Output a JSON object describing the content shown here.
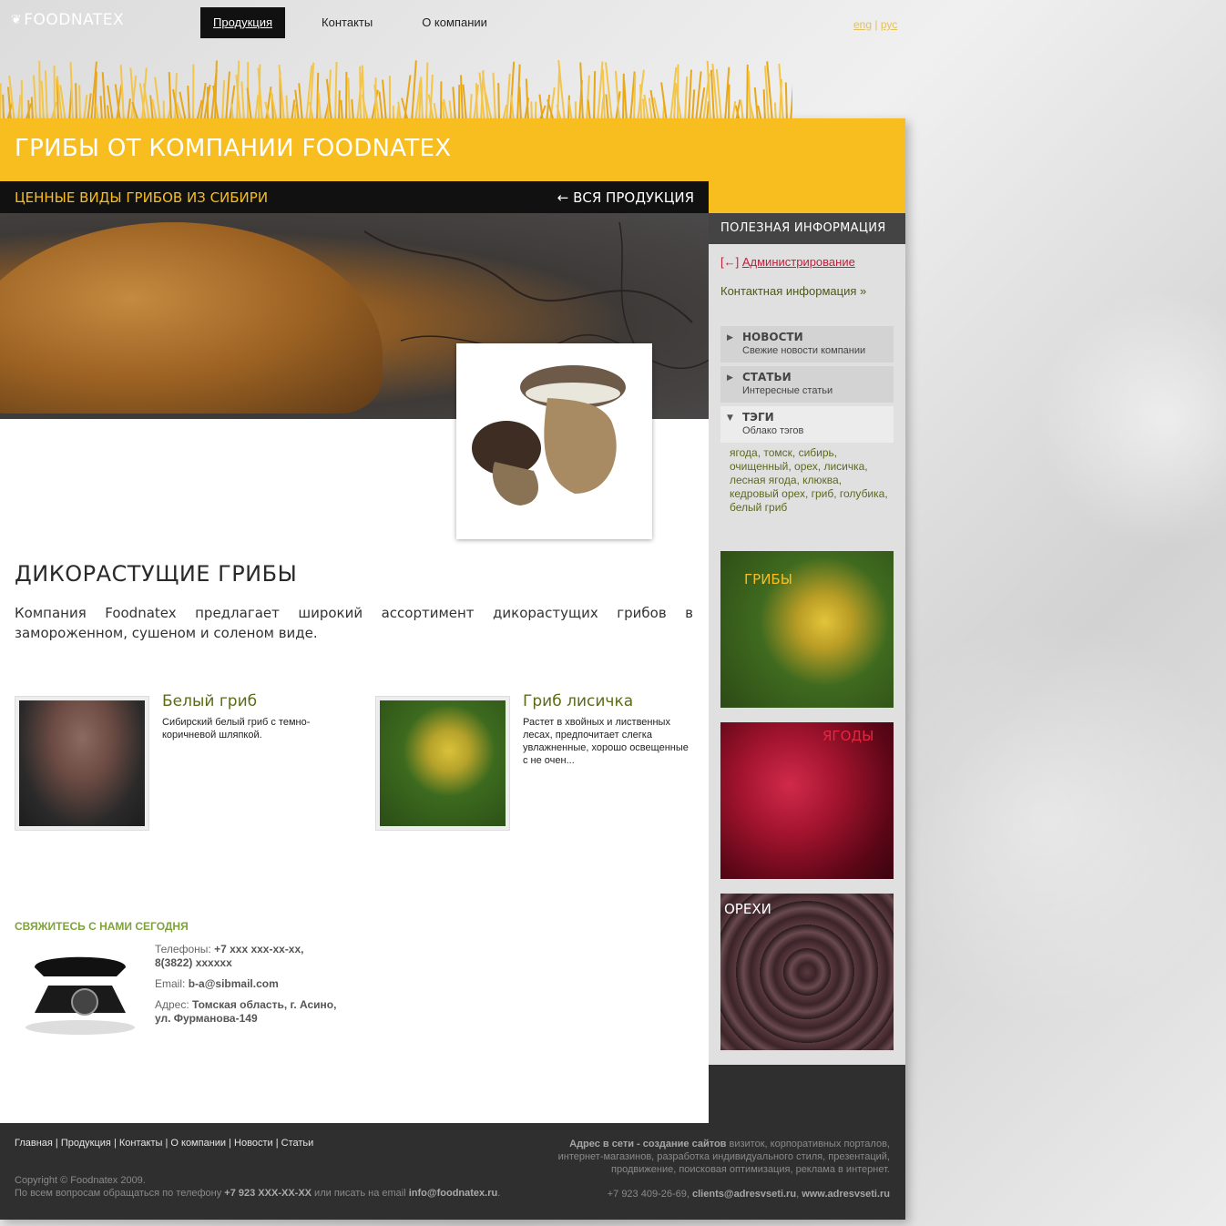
{
  "logo": {
    "text": "FOODNATEX"
  },
  "topnav": [
    {
      "label": "Продукция",
      "active": true
    },
    {
      "label": "Контакты",
      "active": false
    },
    {
      "label": "О компании",
      "active": false
    }
  ],
  "lang": {
    "eng": "eng",
    "sep": " | ",
    "rus": "рус"
  },
  "header": {
    "title": "ГРИБЫ ОТ КОМПАНИИ FOODNATEX",
    "subtitle": "ЦЕННЫЕ ВИДЫ ГРИБОВ ИЗ СИБИРИ",
    "back_link": "← ВСЯ ПРОДУКЦИЯ"
  },
  "main": {
    "heading": "ДИКОРАСТУЩИЕ ГРИБЫ",
    "intro": "Компания Foodnatex предлагает широкий ассортимент дикорастущих грибов в замороженном, сушеном и соленом виде.",
    "products": [
      {
        "name": "Белый гриб",
        "desc": "Сибирский белый гриб с темно-коричневой шляпкой."
      },
      {
        "name": "Гриб лисичка",
        "desc": "Растет в хвойных и лиственных лесах, предпочитает слегка увлажненные, хорошо освещенные с не очен..."
      }
    ]
  },
  "contact": {
    "heading": "СВЯЖИТЕСЬ С НАМИ СЕГОДНЯ",
    "phones_label": "Телефоны: ",
    "phones": "+7 xxx xxx-xx-xx, 8(3822) xxxxxx",
    "email_label": "Email: ",
    "email": "b-a@sibmail.com",
    "address_label": "Адрес: ",
    "address": "Томская область, г. Асино, ул. Фурманова-149"
  },
  "sidebar": {
    "heading": "ПОЛЕЗНАЯ ИНФОРМАЦИЯ",
    "admin_prefix": "[←]",
    "admin_link": "Администрирование",
    "contact_link": "Контактная информация »",
    "accordion": [
      {
        "title": "НОВОСТИ",
        "sub": "Свежие новости компании",
        "open": false
      },
      {
        "title": "СТАТЬИ",
        "sub": "Интересные статьи",
        "open": false
      },
      {
        "title": "ТЭГИ",
        "sub": "Облако тэгов",
        "open": true
      }
    ],
    "tags": "ягода, томск, сибирь, очищенный, орех, лисичка, лесная ягода, клюква, кедровый орех, гриб, голубика, белый гриб",
    "tiles": [
      {
        "label": "ГРИБЫ",
        "color": "#f8be1f"
      },
      {
        "label": "ЯГОДЫ",
        "color": "#e8263f"
      },
      {
        "label": "ОРЕХИ",
        "color": "#ffffff"
      }
    ]
  },
  "footer": {
    "nav": [
      "Главная",
      "Продукция",
      "Контакты",
      "О компании",
      "Новости",
      "Статьи"
    ],
    "copyright": "Copyright © Foodnatex 2009.",
    "support_text_1": "По всем вопросам обращаться по телефону ",
    "support_phone": "+7 923 XXX-XX-XX",
    "support_text_2": " или писать на email ",
    "support_email": "info@foodnatex.ru",
    "support_text_3": ".",
    "agency_bold": "Адрес в сети - создание сайтов",
    "agency_text": " визиток, корпоративных порталов, интернет-магазинов, разработка индивидуального стиля, презентаций, продвижение, поисковая оптимизация, реклама в интернет.",
    "agency_phone": "+7 923 409-26-69, ",
    "agency_email": "clients@adresvseti.ru",
    "agency_sep": ", ",
    "agency_site": "www.adresvseti.ru"
  },
  "colors": {
    "accent_yellow": "#f8be1f",
    "link_green": "#5f6a16",
    "admin_red": "#c0203a",
    "footer_bg": "#2f2f2f"
  }
}
